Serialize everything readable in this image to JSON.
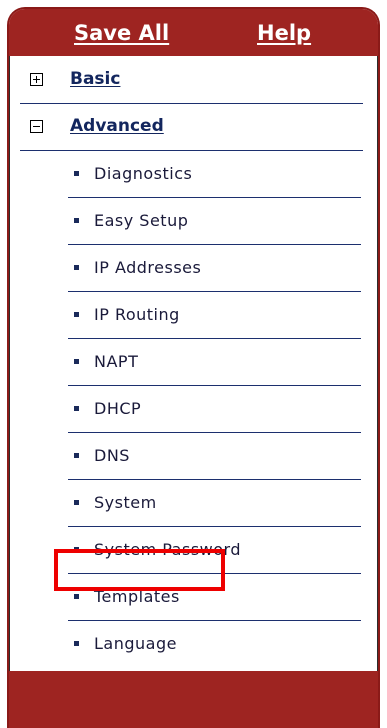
{
  "header": {
    "save_all_label": "Save All",
    "help_label": "Help"
  },
  "nav": {
    "basic": {
      "label": "Basic",
      "expanded": false
    },
    "advanced": {
      "label": "Advanced",
      "expanded": true
    },
    "advanced_items": [
      {
        "label": "Diagnostics"
      },
      {
        "label": "Easy Setup"
      },
      {
        "label": "IP Addresses"
      },
      {
        "label": "IP Routing"
      },
      {
        "label": "NAPT"
      },
      {
        "label": "DHCP"
      },
      {
        "label": "DNS"
      },
      {
        "label": "System",
        "highlighted": true
      },
      {
        "label": "System Password"
      },
      {
        "label": "Templates"
      },
      {
        "label": "Language"
      }
    ]
  },
  "colors": {
    "brand": "#9e2421",
    "link": "#13265e",
    "highlight": "#ee0000"
  },
  "icons": {
    "collapsed": "expand-plus-icon",
    "expanded": "collapse-minus-icon",
    "bullet": "bullet-icon"
  }
}
